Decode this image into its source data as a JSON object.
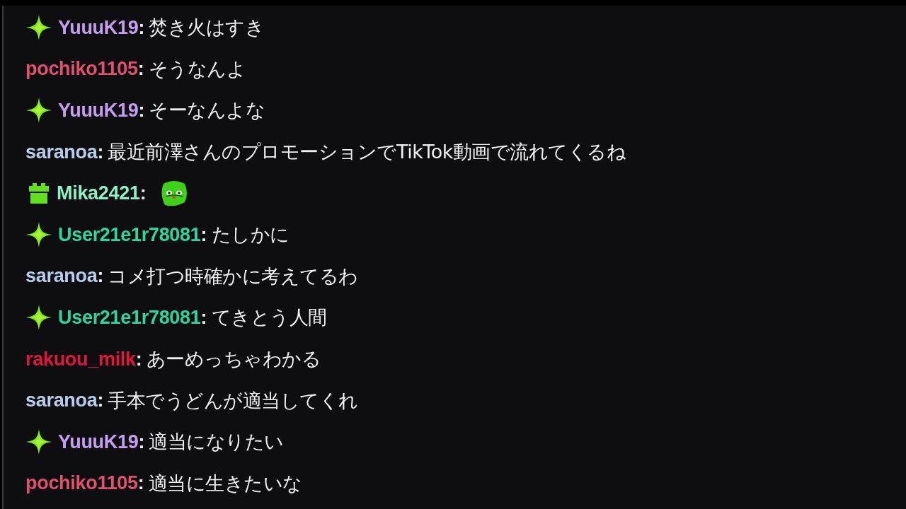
{
  "messages": [
    {
      "kind": "text",
      "badge": {
        "kind": "sparkle"
      },
      "user": "YuuuK19",
      "color": "#c79df2",
      "colon": ":",
      "text": "焚き火はすき"
    },
    {
      "kind": "text",
      "user": "pochiko1105",
      "color": "#e2506f",
      "colon": ":",
      "text": "そうなんよ"
    },
    {
      "kind": "text",
      "badge": {
        "kind": "sparkle"
      },
      "user": "YuuuK19",
      "color": "#c79df2",
      "colon": ":",
      "text": "そーなんよな"
    },
    {
      "kind": "text",
      "user": "saranoa",
      "color": "#b9cdee",
      "colon": ":",
      "text": "最近前澤さんのプロモーションでTikTok動画で流れてくるね"
    },
    {
      "kind": "emote",
      "badge": {
        "kind": "gift"
      },
      "user": "Mika2421",
      "color": "#8fefc9",
      "colon": ":"
    },
    {
      "kind": "text",
      "badge": {
        "kind": "sparkle"
      },
      "user": "User21e1r78081",
      "color": "#2cd6a3",
      "colon": ":",
      "text": "たしかに"
    },
    {
      "kind": "text",
      "user": "saranoa",
      "color": "#b9cdee",
      "colon": ":",
      "text": "コメ打つ時確かに考えてるわ"
    },
    {
      "kind": "text",
      "badge": {
        "kind": "sparkle"
      },
      "user": "User21e1r78081",
      "color": "#2cd6a3",
      "colon": ":",
      "text": "てきとう人間"
    },
    {
      "kind": "text",
      "user": "rakuou_milk",
      "color": "#e0163d",
      "colon": ":",
      "text": "あーめっちゃわかる"
    },
    {
      "kind": "text",
      "user": "saranoa",
      "color": "#b9cdee",
      "colon": ":",
      "text": "手本でうどんが適当してくれ"
    },
    {
      "kind": "text",
      "badge": {
        "kind": "sparkle"
      },
      "user": "YuuuK19",
      "color": "#c79df2",
      "colon": ":",
      "text": "適当になりたい"
    },
    {
      "kind": "text",
      "user": "pochiko1105",
      "color": "#e2506f",
      "colon": ":",
      "text": "適当に生きたいな"
    }
  ]
}
